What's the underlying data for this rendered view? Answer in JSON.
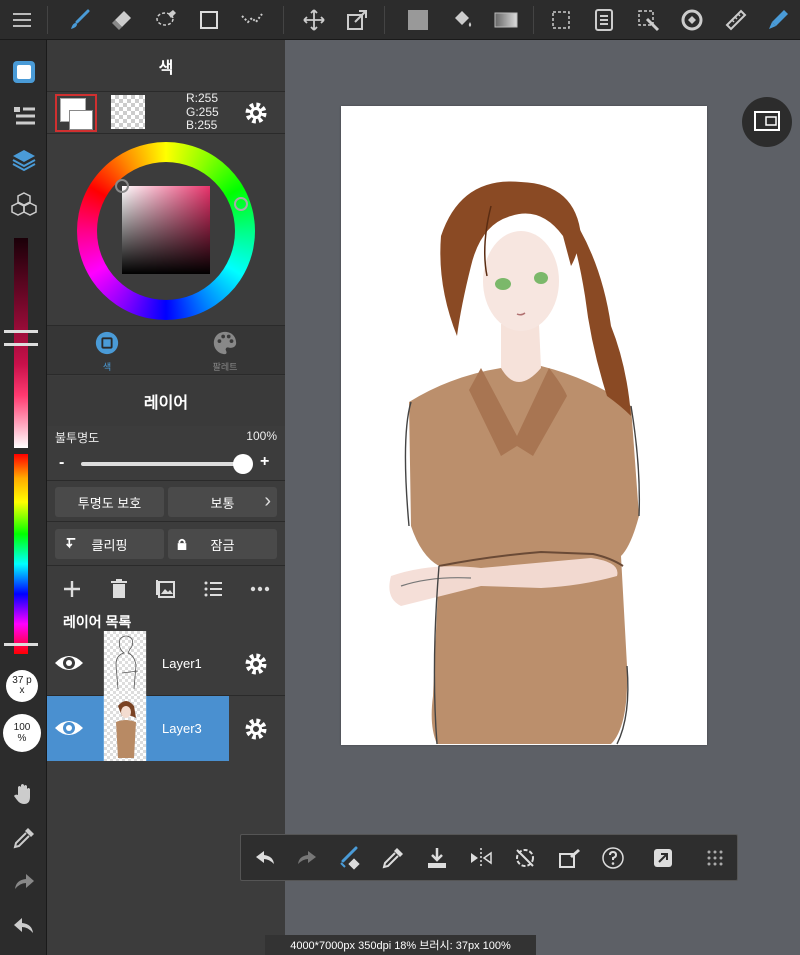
{
  "color_panel": {
    "title": "색",
    "rgb": {
      "r": "R:255",
      "g": "G:255",
      "b": "B:255"
    },
    "tabs": [
      {
        "label": "색"
      },
      {
        "label": "팔레트"
      }
    ]
  },
  "layer_panel": {
    "title": "레이어",
    "opacity_label": "불투명도",
    "opacity_value": "100%",
    "opacity_fraction": 1.0,
    "minus": "-",
    "plus": "+",
    "alpha_lock": "투명도 보호",
    "blend_mode": "보통",
    "clipping": "클리핑",
    "lock": "잠금",
    "list_title": "레이어 목록",
    "layers": [
      {
        "name": "Layer1",
        "selected": false
      },
      {
        "name": "Layer3",
        "selected": true
      }
    ]
  },
  "left_tools": {
    "brush_size": "37 px",
    "brush_opacity": "100 %"
  },
  "status": {
    "text": "4000*7000px 350dpi 18% 브러시: 37px 100%"
  },
  "colors": {
    "accent": "#4a9bd7",
    "selected_layer": "#4a90d0",
    "toolbar_bg": "#2c2c2c",
    "canvas_bg": "#5d6066"
  }
}
